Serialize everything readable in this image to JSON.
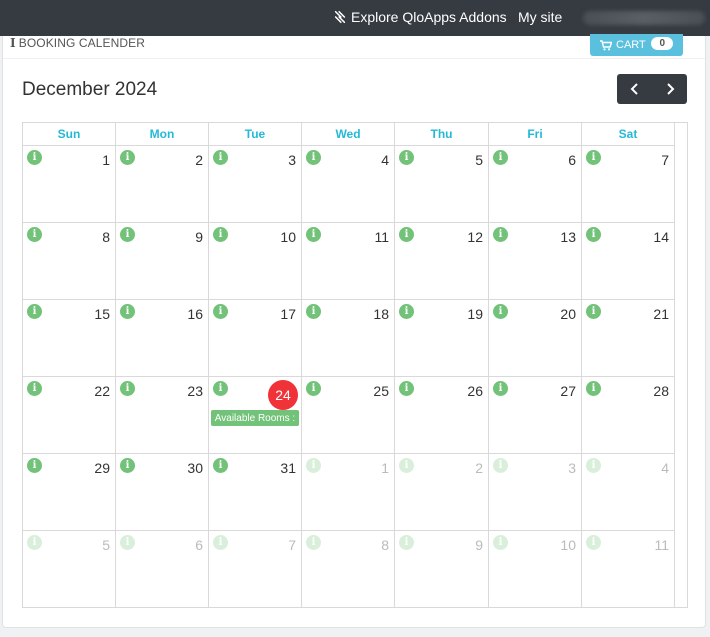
{
  "topbar": {
    "addons_label": "Explore QloApps Addons",
    "mysite_label": "My site"
  },
  "panel": {
    "title": "BOOKING CALENDER",
    "cart_label": "CART",
    "cart_count": "0"
  },
  "calendar": {
    "month_title": "December 2024",
    "prev_icon": "chevron-left-icon",
    "next_icon": "chevron-right-icon",
    "weekdays": [
      "Sun",
      "Mon",
      "Tue",
      "Wed",
      "Thu",
      "Fri",
      "Sat"
    ],
    "weeks": [
      [
        {
          "d": "1"
        },
        {
          "d": "2"
        },
        {
          "d": "3"
        },
        {
          "d": "4"
        },
        {
          "d": "5"
        },
        {
          "d": "6"
        },
        {
          "d": "7"
        }
      ],
      [
        {
          "d": "8"
        },
        {
          "d": "9"
        },
        {
          "d": "10"
        },
        {
          "d": "11"
        },
        {
          "d": "12"
        },
        {
          "d": "13"
        },
        {
          "d": "14"
        }
      ],
      [
        {
          "d": "15"
        },
        {
          "d": "16"
        },
        {
          "d": "17"
        },
        {
          "d": "18"
        },
        {
          "d": "19"
        },
        {
          "d": "20"
        },
        {
          "d": "21"
        }
      ],
      [
        {
          "d": "22"
        },
        {
          "d": "23"
        },
        {
          "d": "24",
          "today": true,
          "badge": "Available Rooms :"
        },
        {
          "d": "25"
        },
        {
          "d": "26"
        },
        {
          "d": "27"
        },
        {
          "d": "28"
        }
      ],
      [
        {
          "d": "29"
        },
        {
          "d": "30"
        },
        {
          "d": "31"
        },
        {
          "d": "1",
          "other": true
        },
        {
          "d": "2",
          "other": true
        },
        {
          "d": "3",
          "other": true
        },
        {
          "d": "4",
          "other": true
        }
      ],
      [
        {
          "d": "5",
          "other": true
        },
        {
          "d": "6",
          "other": true
        },
        {
          "d": "7",
          "other": true
        },
        {
          "d": "8",
          "other": true
        },
        {
          "d": "9",
          "other": true
        },
        {
          "d": "10",
          "other": true
        },
        {
          "d": "11",
          "other": true
        }
      ]
    ]
  },
  "colors": {
    "topbar": "#363a41",
    "accent": "#25b9d7",
    "info_green": "#72c279",
    "today_red": "#ef3339",
    "cart_blue": "#5bc0de"
  }
}
